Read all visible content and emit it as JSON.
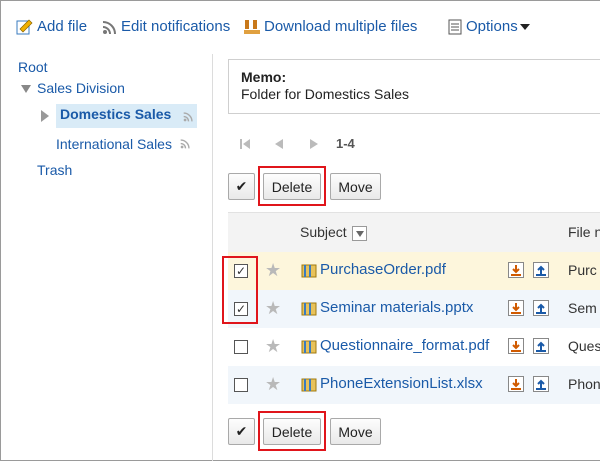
{
  "toolbar": {
    "add_file": "Add file",
    "edit_notifications": "Edit notifications",
    "download_multiple": "Download multiple files",
    "options": "Options"
  },
  "tree": {
    "root": "Root",
    "division": "Sales Division",
    "domestic": "Domestics Sales",
    "international": "International Sales",
    "trash": "Trash"
  },
  "memo": {
    "label": "Memo:",
    "text": "Folder for Domestics Sales"
  },
  "pager": {
    "range": "1-4"
  },
  "actions": {
    "delete": "Delete",
    "move": "Move",
    "check_all": "✔"
  },
  "table": {
    "col_subject": "Subject",
    "col_filename": "File n",
    "rows": [
      {
        "subject": "PurchaseOrder.pdf",
        "file": "Purc",
        "checked": true
      },
      {
        "subject": "Seminar materials.pptx",
        "file": "Sem",
        "checked": true
      },
      {
        "subject": "Questionnaire_format.pdf",
        "file": "Ques",
        "checked": false
      },
      {
        "subject": "PhoneExtensionList.xlsx",
        "file": "Phon",
        "checked": false
      }
    ],
    "check_mark": "✓"
  },
  "colors": {
    "link": "#1a5aa8",
    "highlight": "#e0151b",
    "selected_folder": "#d9ebf7"
  }
}
